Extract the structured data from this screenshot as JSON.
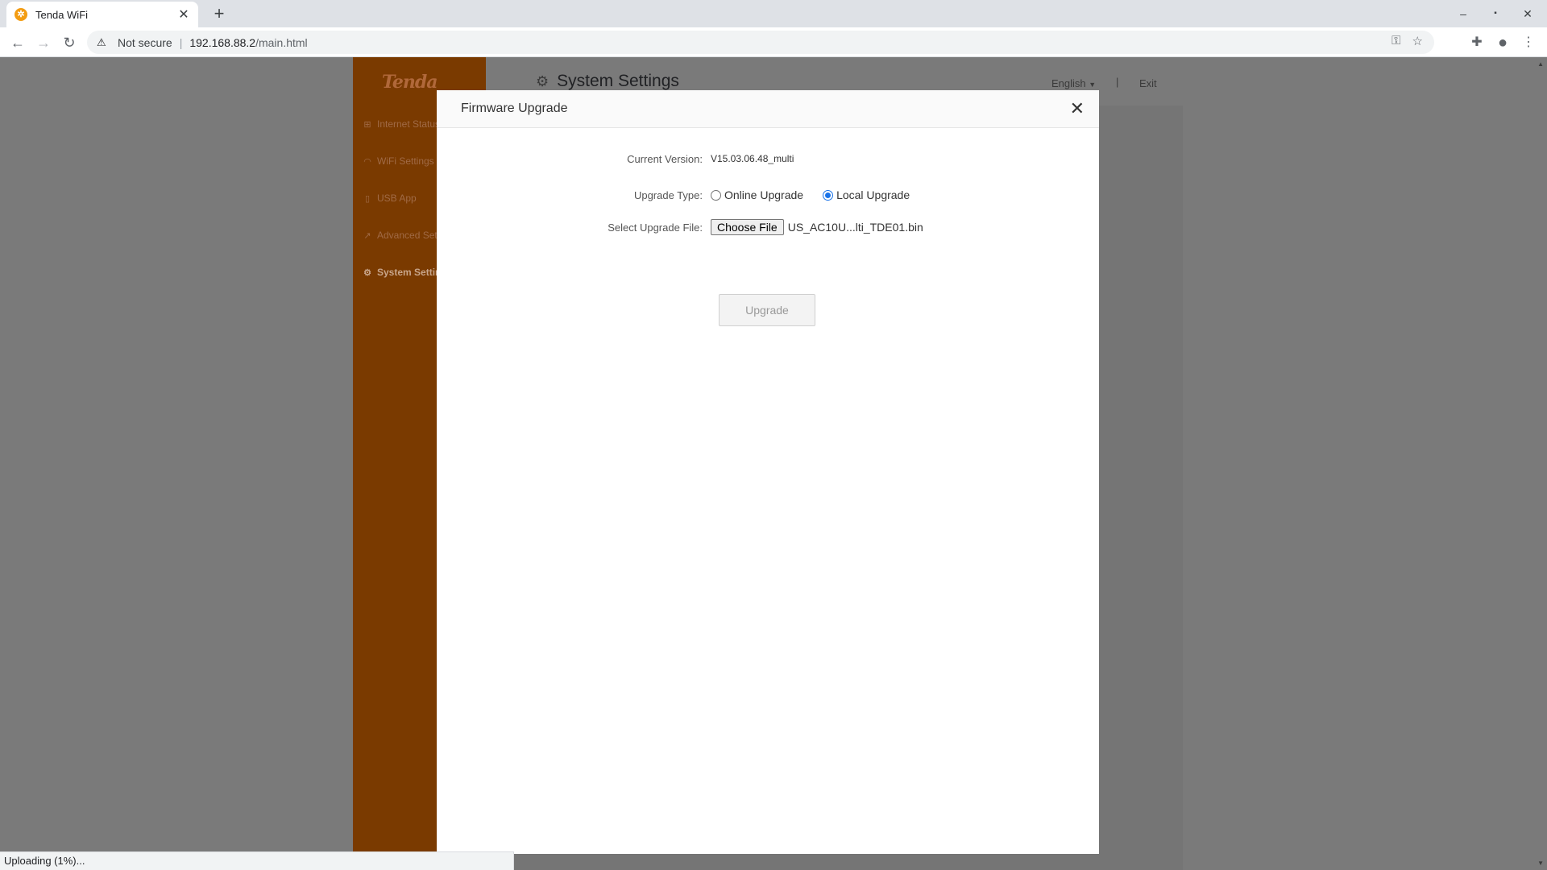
{
  "browser": {
    "tab_title": "Tenda WiFi",
    "new_tab": "+",
    "security": "Not secure",
    "url_host": "192.168.88.2",
    "url_path": "/main.html",
    "status_text": "Uploading (1%)..."
  },
  "app": {
    "logo": "Tenda",
    "sidebar": [
      {
        "label": "Internet Status",
        "icon": "network-icon"
      },
      {
        "label": "WiFi Settings",
        "icon": "wifi-icon"
      },
      {
        "label": "USB App",
        "icon": "usb-icon"
      },
      {
        "label": "Advanced Settings",
        "icon": "wrench-icon"
      },
      {
        "label": "System Settings",
        "icon": "gear-icon",
        "active": true
      }
    ],
    "page_title": "System Settings",
    "language": "English",
    "exit": "Exit"
  },
  "modal": {
    "title": "Firmware Upgrade",
    "current_version_label": "Current Version:",
    "current_version": "V15.03.06.48_multi",
    "upgrade_type_label": "Upgrade Type:",
    "online_upgrade": "Online Upgrade",
    "local_upgrade": "Local Upgrade",
    "selected_type": "Local Upgrade",
    "select_file_label": "Select Upgrade File:",
    "choose_file": "Choose File",
    "file_name": "US_AC10U...lti_TDE01.bin",
    "upgrade_button": "Upgrade"
  },
  "colors": {
    "sidebar_bg": "#7a3a00",
    "overlay": "#7a7a7a",
    "radio_accent": "#1a73e8"
  }
}
